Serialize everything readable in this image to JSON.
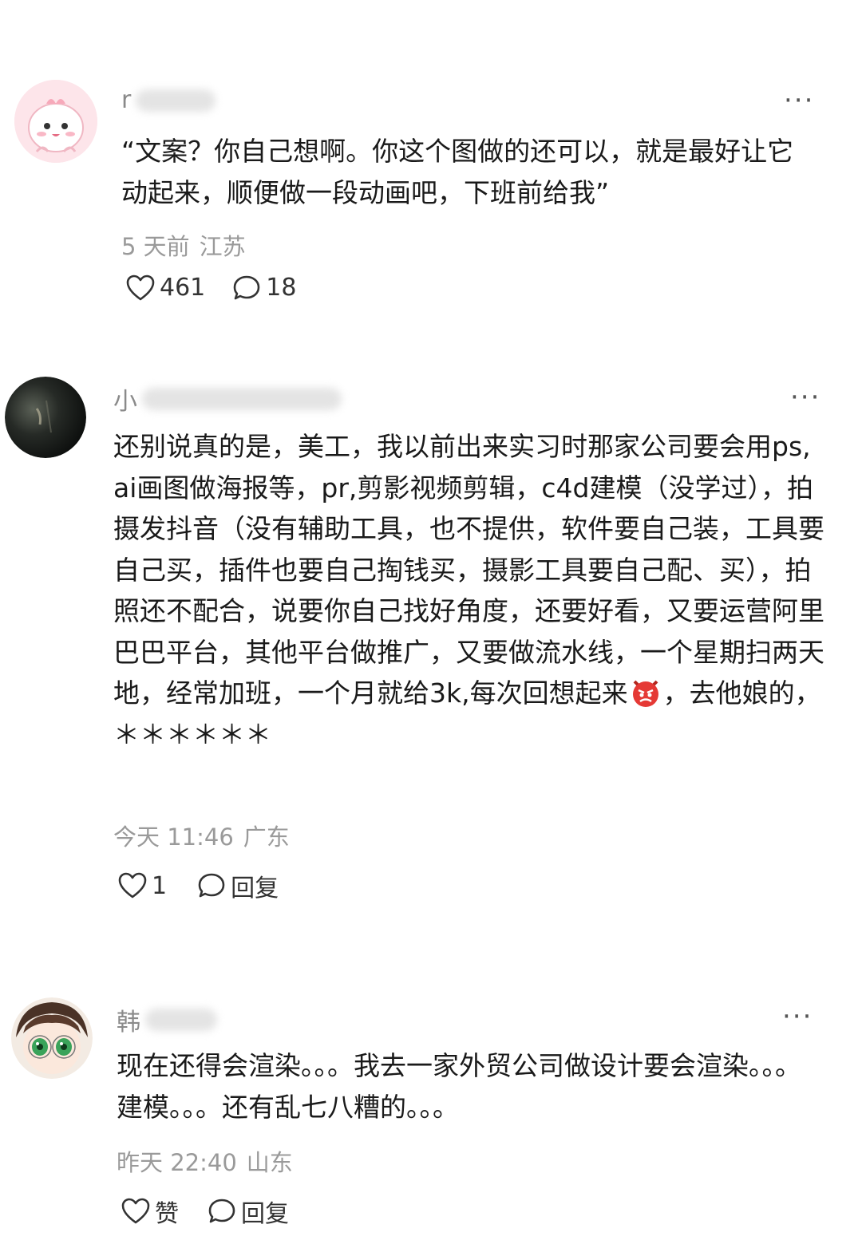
{
  "comments": [
    {
      "username_visible": "r",
      "text": "“文案？你自己想啊。你这个图做的还可以，就是最好让它动起来，顺便做一段动画吧，下班前给我”",
      "time": "5 天前",
      "location": "江苏",
      "like_label": "461",
      "reply_label": "18",
      "avatar_icon": "pink-cartoon-avatar",
      "colors": {
        "avatar_bg": "#fbe1e6"
      }
    },
    {
      "username_visible": "小",
      "text_before_emoji": "还别说真的是，美工，我以前出来实习时那家公司要会用ps,ai画图做海报等，pr,剪影视频剪辑，c4d建模（没学过），拍摄发抖音（没有辅助工具，也不提供，软件要自己装，工具要自己买，插件也要自己掏钱买，摄影工具要自己配、买），拍照还不配合，说要你自己找好角度，还要好看，又要运营阿里巴巴平台，其他平台做推广，又要做流水线，一个星期扫两天地，经常加班，一个月就给3k,每次回想起来",
      "emoji": "angry-face",
      "text_after_emoji": "，去他娘的，＊＊＊＊＊＊",
      "time": "今天 11:46",
      "location": "广东",
      "like_label": "1",
      "reply_label": "回复",
      "avatar_icon": "dark-photo-avatar",
      "colors": {
        "avatar_bg": "#1b1f1c"
      }
    },
    {
      "username_visible": "韩",
      "text": "现在还得会渲染。。。我去一家外贸公司做设计要会渲染。。。建模。。。还有乱七八糟的。。。",
      "time": "昨天 22:40",
      "location": "山东",
      "like_label": "赞",
      "reply_label": "回复",
      "avatar_icon": "anime-girl-avatar",
      "colors": {
        "avatar_bg": "#f3ebe3"
      }
    }
  ],
  "more_label": "···",
  "icons": {
    "like": "heart-outline-icon",
    "reply": "speech-bubble-icon",
    "more": "more-dots-icon"
  }
}
